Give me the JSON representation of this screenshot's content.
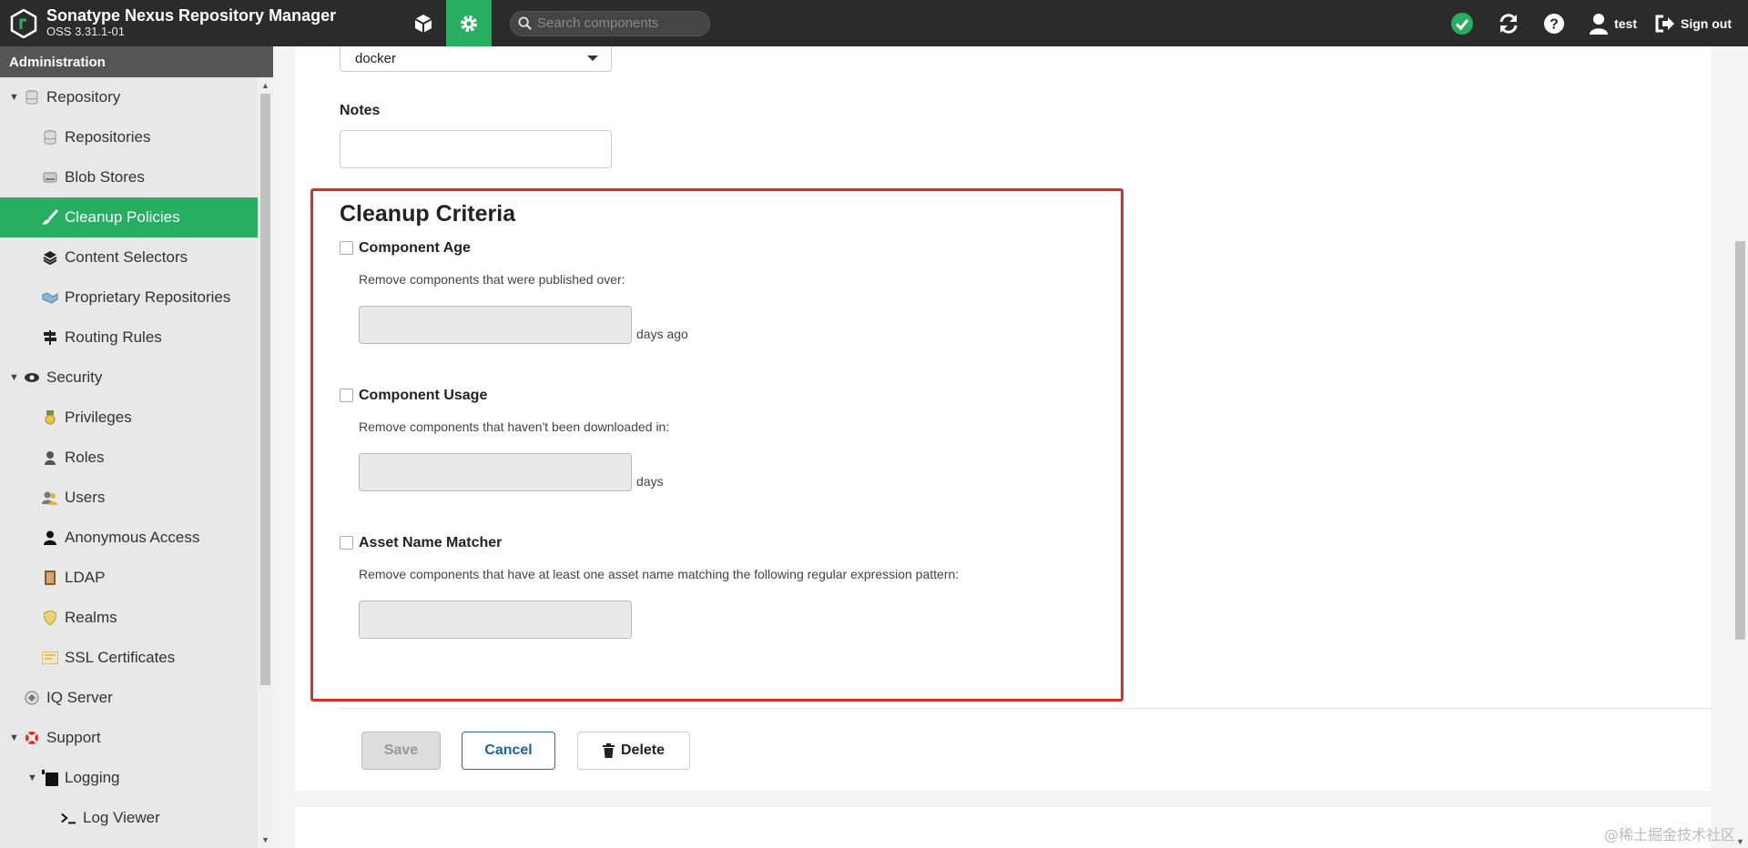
{
  "app": {
    "title": "Sonatype Nexus Repository Manager",
    "version": "OSS 3.31.1-01",
    "accent_color": "#27ae60",
    "topbar_color": "#2b2b2b"
  },
  "topbar": {
    "nav": [
      {
        "name": "browse-icon"
      },
      {
        "name": "gear-icon",
        "active": true
      }
    ],
    "search_placeholder": "Search components",
    "status_icon": "check-circle-icon",
    "user": "test",
    "signout": "Sign out"
  },
  "sidebar": {
    "header": "Administration",
    "items": [
      {
        "label": "Repository",
        "level": 0,
        "expanded": true,
        "icon": "database-icon"
      },
      {
        "label": "Repositories",
        "level": 1,
        "icon": "database-icon"
      },
      {
        "label": "Blob Stores",
        "level": 1,
        "icon": "hard-drive-icon"
      },
      {
        "label": "Cleanup Policies",
        "level": 1,
        "icon": "brush-icon",
        "selected": true
      },
      {
        "label": "Content Selectors",
        "level": 1,
        "icon": "layers-icon"
      },
      {
        "label": "Proprietary Repositories",
        "level": 1,
        "icon": "handshake-icon"
      },
      {
        "label": "Routing Rules",
        "level": 1,
        "icon": "signs-icon"
      },
      {
        "label": "Security",
        "level": 0,
        "expanded": true,
        "icon": "eye-icon"
      },
      {
        "label": "Privileges",
        "level": 1,
        "icon": "medal-icon"
      },
      {
        "label": "Roles",
        "level": 1,
        "icon": "role-icon"
      },
      {
        "label": "Users",
        "level": 1,
        "icon": "users-icon"
      },
      {
        "label": "Anonymous Access",
        "level": 1,
        "icon": "user-icon"
      },
      {
        "label": "LDAP",
        "level": 1,
        "icon": "book-icon"
      },
      {
        "label": "Realms",
        "level": 1,
        "icon": "shield-icon"
      },
      {
        "label": "SSL Certificates",
        "level": 1,
        "icon": "certificate-icon"
      },
      {
        "label": "IQ Server",
        "level": 0,
        "icon": "iq-icon"
      },
      {
        "label": "Support",
        "level": 0,
        "expanded": true,
        "icon": "lifebuoy-icon"
      },
      {
        "label": "Logging",
        "level": 1,
        "expanded": true,
        "icon": "logging-icon"
      },
      {
        "label": "Log Viewer",
        "level": 2,
        "icon": "terminal-icon"
      }
    ]
  },
  "form": {
    "format_value": "docker",
    "notes_label": "Notes",
    "notes_value": "",
    "section_title": "Cleanup Criteria",
    "criteria": [
      {
        "label": "Component Age",
        "desc": "Remove components that were published over:",
        "unit": "days ago",
        "checked": false
      },
      {
        "label": "Component Usage",
        "desc": "Remove components that haven't been downloaded in:",
        "unit": "days",
        "checked": false
      },
      {
        "label": "Asset Name Matcher",
        "desc": "Remove components that have at least one asset name matching the following regular expression pattern:",
        "unit": "",
        "checked": false
      }
    ],
    "buttons": {
      "save": "Save",
      "cancel": "Cancel",
      "delete": "Delete"
    }
  },
  "watermark": "@稀土掘金技术社区"
}
